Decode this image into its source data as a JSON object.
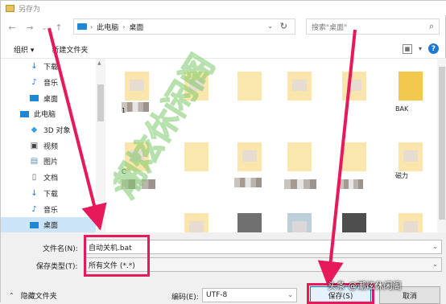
{
  "window": {
    "title": "另存为"
  },
  "address": {
    "segments": [
      "此电脑",
      "桌面"
    ]
  },
  "search": {
    "placeholder": "搜索\"桌面\""
  },
  "toolbar": {
    "organize": "组织 ▾",
    "new_folder": "新建文件夹"
  },
  "sidebar": {
    "items": [
      {
        "label": "下载",
        "icon": "download-icon"
      },
      {
        "label": "音乐",
        "icon": "music-icon"
      },
      {
        "label": "桌面",
        "icon": "desktop-icon"
      },
      {
        "label": "此电脑",
        "icon": "pc-icon"
      },
      {
        "label": "3D 对象",
        "icon": "3d-objects-icon"
      },
      {
        "label": "视频",
        "icon": "video-icon"
      },
      {
        "label": "图片",
        "icon": "pictures-icon"
      },
      {
        "label": "文档",
        "icon": "documents-icon"
      },
      {
        "label": "下载",
        "icon": "download-icon"
      },
      {
        "label": "音乐",
        "icon": "music-icon"
      },
      {
        "label": "桌面",
        "icon": "desktop-icon"
      }
    ]
  },
  "content": {
    "files": [
      {
        "label": "1"
      },
      {
        "label": ""
      },
      {
        "label": ""
      },
      {
        "label": ""
      },
      {
        "label": ""
      },
      {
        "label": "BAK"
      },
      {
        "label": "C"
      },
      {
        "label": ""
      },
      {
        "label": ""
      },
      {
        "label": ""
      },
      {
        "label": ""
      },
      {
        "label": "磁力"
      }
    ]
  },
  "form": {
    "filename_label": "文件名(N):",
    "filename_value": "自动关机.bat",
    "filetype_label": "保存类型(T):",
    "filetype_value": "所有文件  (*.*)",
    "encoding_label": "编码(E):",
    "encoding_value": "UTF-8",
    "hide_folders": "隐藏文件夹",
    "save": "保存(S)",
    "cancel": "取消"
  },
  "overlay": {
    "watermark": "潮炫休闲阁",
    "credit": "头条 @潮炫休闲阁"
  },
  "colors": {
    "highlight": "#e8195a",
    "accent": "#1e78d2",
    "watermark": "#7cc96a"
  }
}
